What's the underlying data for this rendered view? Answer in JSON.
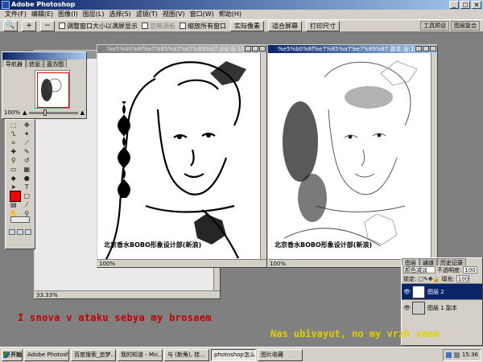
{
  "window": {
    "title": "Adobe Photoshop"
  },
  "menu": [
    "文件(F)",
    "编辑(E)",
    "图像(I)",
    "图层(L)",
    "选择(S)",
    "滤镜(T)",
    "视图(V)",
    "窗口(W)",
    "帮助(H)"
  ],
  "options": {
    "resize_windows": "调整窗口大小以满屏显示",
    "ignore_palettes": "忽略调板",
    "zoom_all": "缩放所有窗口",
    "actual_pixels": "实际像素",
    "fit_screen": "适合屏幕",
    "print_size": "打印尺寸",
    "palette_tabs": [
      "工具预设",
      "图层复合"
    ]
  },
  "navigator": {
    "tabs": [
      "导航器",
      "信息",
      "直方图"
    ],
    "zoom": "100%"
  },
  "docs": {
    "back": {
      "status": "33.33%"
    },
    "left": {
      "title": "%e5%b0%8f%e7%85%a7%e7%89%87.jpg @ 100%",
      "status": "100%",
      "watermark": "北京香水BOBO形象设计部(新浪)"
    },
    "right": {
      "title": "%e5%b0%8f%e7%85%a7%e7%89%87 副本 @ 100%",
      "status": "100%",
      "watermark": "北京香水BOBO形象设计部(新浪)"
    }
  },
  "layers": {
    "tabs": [
      "图层",
      "通道",
      "历史记录"
    ],
    "blend_mode": "颜色减淡",
    "opacity_label": "不透明度:",
    "opacity": "100",
    "lock_label": "锁定:",
    "fill_label": "填充:",
    "fill": "100",
    "items": [
      {
        "name": "图层 2",
        "selected": true
      },
      {
        "name": "图层 1 副本",
        "selected": false
      }
    ]
  },
  "subtitles": {
    "line1": "I snova v ataku sebya my brosaem",
    "line2": "Nas ubivayut, no my vrzh vaem"
  },
  "taskbar": {
    "start": "开始",
    "buttons": [
      "Adobe Photoshop",
      "百度搜索_追梦...",
      "我的知道 - Mic...",
      "与 (新角), 挂...",
      "photoshop怎么...",
      "图片收藏"
    ],
    "active_index": 4,
    "time": "15:36"
  },
  "colors": {
    "foreground": "#ff0000",
    "background": "#ffffff",
    "title_active": "#0a246a"
  }
}
